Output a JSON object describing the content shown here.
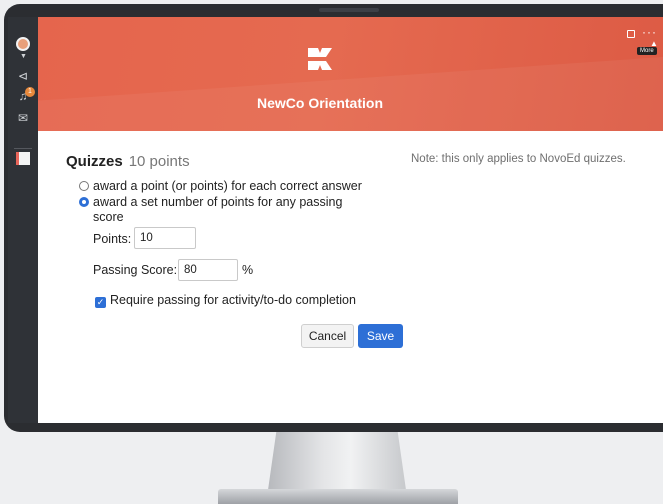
{
  "header": {
    "course_title": "NewCo Orientation",
    "more_tooltip": "More",
    "more_glyph": "···",
    "brand_color": "#e5654d"
  },
  "sidebar": {
    "notification_count": "1"
  },
  "quizzes": {
    "title": "Quizzes",
    "points": "10 points",
    "note": "Note: this only applies to NovoEd quizzes.",
    "option_each_correct": "award a point (or points) for each correct answer",
    "option_set_number": "award a set number of points for any passing score",
    "selected_option": "award a set number of points for any passing score",
    "points_label": "Points:",
    "points_value": "10",
    "passing_label": "Passing Score:",
    "passing_value": "80",
    "percent_sign": "%",
    "require_passing_label": "Require passing for activity/to-do completion",
    "require_passing_checked": true
  },
  "actions": {
    "cancel_label": "Cancel",
    "save_label": "Save",
    "accent_color": "#2d6fd6"
  }
}
